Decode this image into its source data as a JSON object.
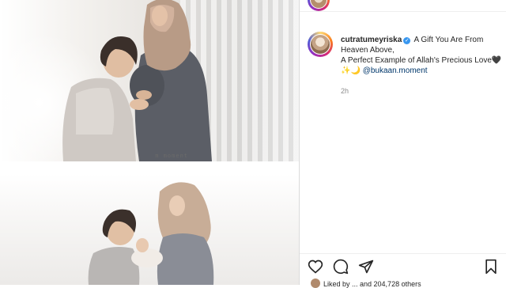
{
  "post": {
    "username": "cutratumeyriska",
    "caption_line1": "A Gift You Are From Heaven Above,",
    "caption_line2": "A Perfect Example of Allah's Precious Love",
    "caption_emoji": "🖤✨🌙",
    "mention": "@bukaan.moment",
    "time": "2h",
    "likes_text": "Liked by  ...  and 204,728 others"
  },
  "media": {
    "watermark": "m moment"
  },
  "icons": {
    "like": "heart-icon",
    "comment": "comment-icon",
    "share": "paper-plane-icon",
    "save": "bookmark-icon",
    "verified": "verified-badge-icon"
  },
  "colors": {
    "verified": "#3897f0",
    "mention": "#00376b",
    "meta": "#8e8e8e",
    "divider": "#dbdbdb"
  }
}
